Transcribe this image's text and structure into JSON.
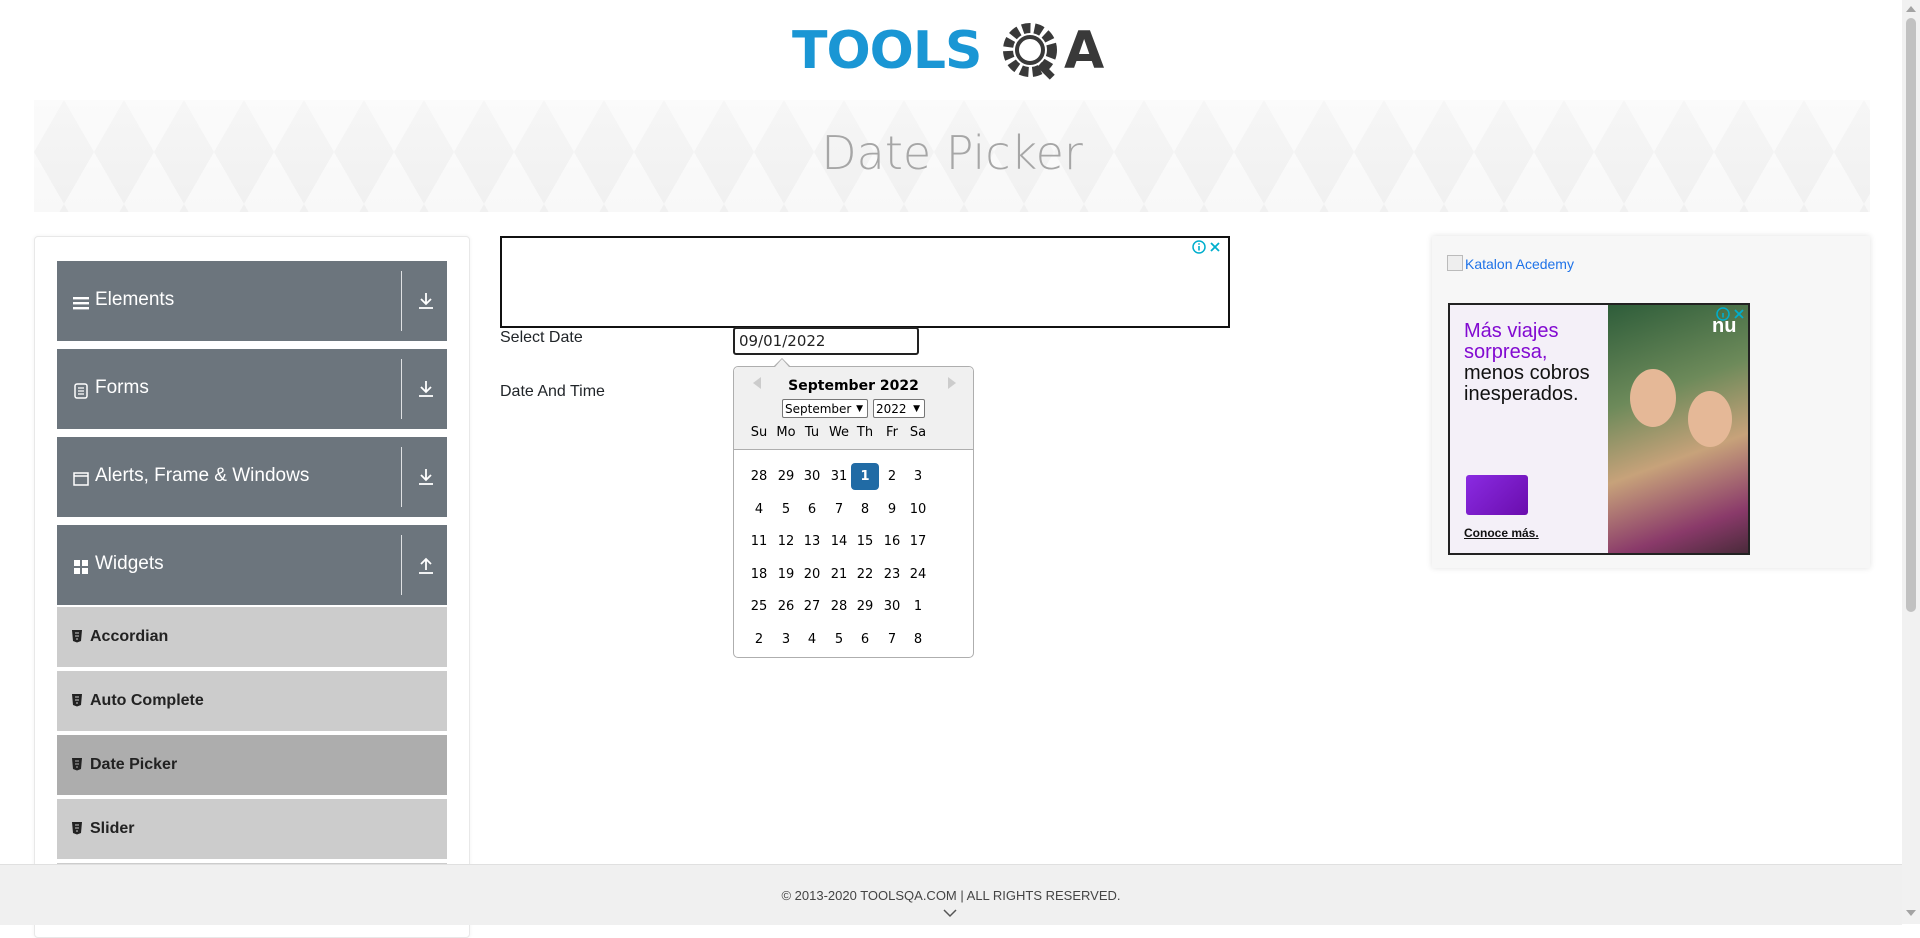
{
  "header": {
    "logo_text_tools": "TOOLS",
    "logo_text_q": "Q",
    "logo_text_a": "A",
    "brand_blue": "#1a96d4",
    "brand_dark": "#393939"
  },
  "banner": {
    "title": "Date Picker"
  },
  "sidebar": {
    "groups": [
      {
        "label": "Elements",
        "icon": "hamburger-icon",
        "arrow": "download-arrow-icon"
      },
      {
        "label": "Forms",
        "icon": "form-icon",
        "arrow": "download-arrow-icon"
      },
      {
        "label": "Alerts, Frame & Windows",
        "icon": "window-icon",
        "arrow": "download-arrow-icon"
      },
      {
        "label": "Widgets",
        "icon": "widgets-grid-icon",
        "arrow": "upload-arrow-icon"
      }
    ],
    "items": [
      {
        "label": "Accordian",
        "active": false
      },
      {
        "label": "Auto Complete",
        "active": false
      },
      {
        "label": "Date Picker",
        "active": true
      },
      {
        "label": "Slider",
        "active": false
      }
    ]
  },
  "form": {
    "select_date_label": "Select Date",
    "date_and_time_label": "Date And Time",
    "select_date_value": "09/01/2022"
  },
  "datepicker": {
    "month_title": "September 2022",
    "month_select": "September",
    "year_select": "2022",
    "weekdays": [
      "Su",
      "Mo",
      "Tu",
      "We",
      "Th",
      "Fr",
      "Sa"
    ],
    "weeks": [
      [
        "28",
        "29",
        "30",
        "31",
        "1",
        "2",
        "3"
      ],
      [
        "4",
        "5",
        "6",
        "7",
        "8",
        "9",
        "10"
      ],
      [
        "11",
        "12",
        "13",
        "14",
        "15",
        "16",
        "17"
      ],
      [
        "18",
        "19",
        "20",
        "21",
        "22",
        "23",
        "24"
      ],
      [
        "25",
        "26",
        "27",
        "28",
        "29",
        "30",
        "1"
      ],
      [
        "2",
        "3",
        "4",
        "5",
        "6",
        "7",
        "8"
      ]
    ],
    "selected_day": "1",
    "selected_color": "#216ba5"
  },
  "right_ad": {
    "broken_image_alt": "Katalon Acedemy",
    "nu_line1": "Más viajes",
    "nu_line2": "sorpresa,",
    "nu_line3": "menos cobros",
    "nu_line4": "inesperados.",
    "nu_cta": "Conoce más.",
    "nu_logo": "nu"
  },
  "footer": {
    "copyright": "© 2013-2020 TOOLSQA.COM | ALL RIGHTS RESERVED."
  }
}
